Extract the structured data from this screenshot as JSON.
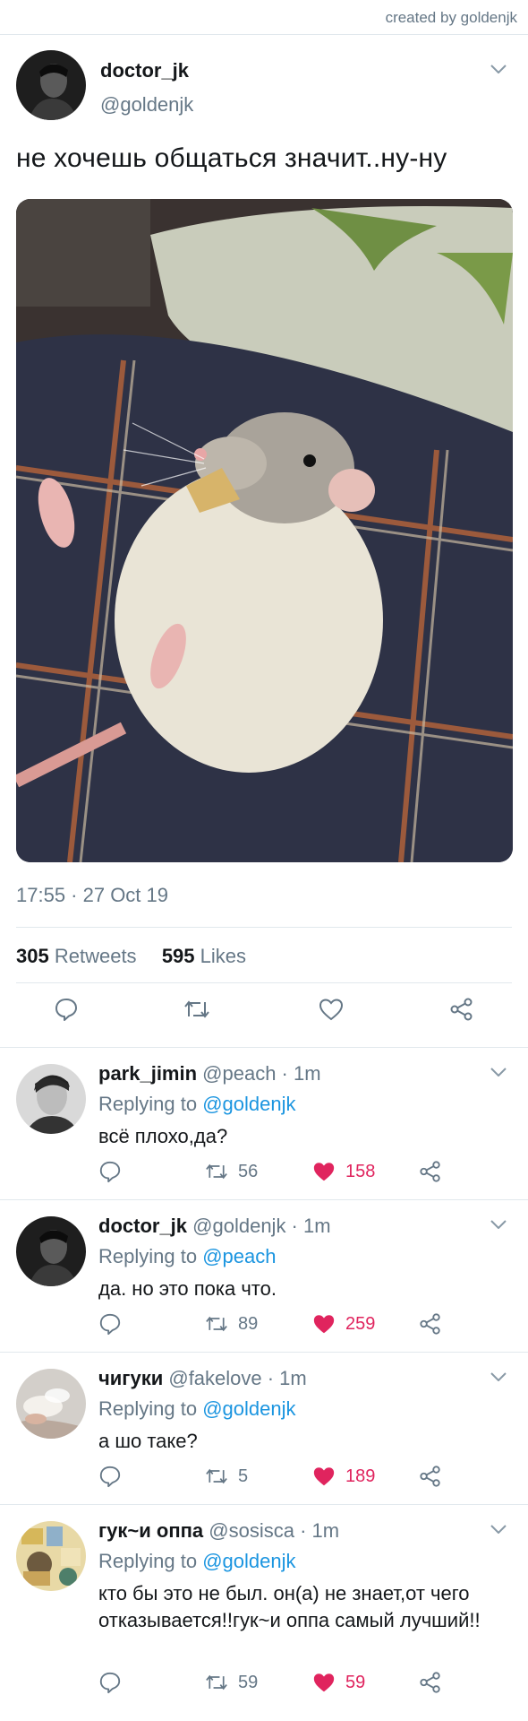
{
  "watermark": "created by goldenjk",
  "tweet": {
    "name": "doctor_jk",
    "handle": "@goldenjk",
    "text": "не хочешь общаться значит..ну-ну",
    "time": "17:55 · 27 Oct 19",
    "retweets": "305",
    "retweets_label": "Retweets",
    "likes": "595",
    "likes_label": "Likes"
  },
  "replies": [
    {
      "name": "park_jimin",
      "handle": "@peach · 1m",
      "replying_prefix": "Replying to",
      "replying_to": "@goldenjk",
      "text": "всё плохо,да?",
      "retweets": "56",
      "likes": "158"
    },
    {
      "name": "doctor_jk",
      "handle": "@goldenjk · 1m",
      "replying_prefix": "Replying to",
      "replying_to": "@peach",
      "text": "да. но это пока что.",
      "retweets": "89",
      "likes": "259"
    },
    {
      "name": "чигуки",
      "handle": "@fakelove · 1m",
      "replying_prefix": "Replying to",
      "replying_to": "@goldenjk",
      "text": "а шо таке?",
      "retweets": "5",
      "likes": "189"
    },
    {
      "name": "гук~и оппа",
      "handle": "@sosisca · 1m",
      "replying_prefix": "Replying to",
      "replying_to": "@goldenjk",
      "text": "кто бы это не был. он(а) не знает,от чего отказывается!!гук~и оппа самый лучший!!",
      "retweets": "59",
      "likes": "59"
    }
  ],
  "colors": {
    "accent": "#1b95e0",
    "like": "#e0245e",
    "muted": "#657786",
    "divider": "#e1e8ed"
  }
}
